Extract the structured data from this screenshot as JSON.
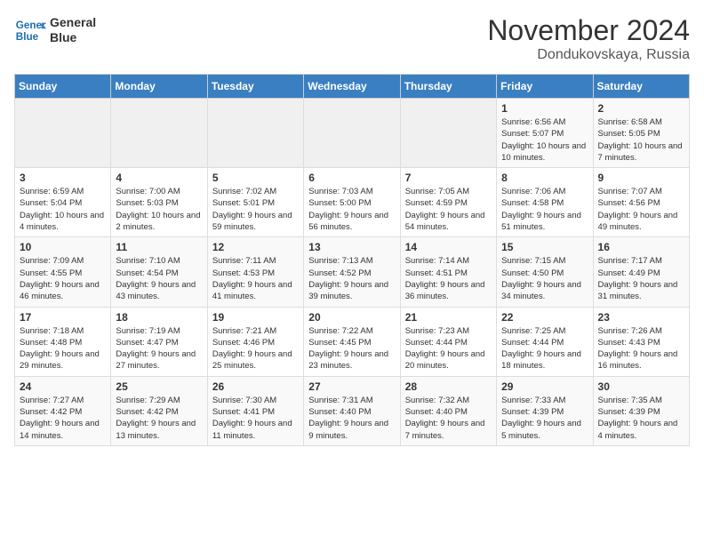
{
  "header": {
    "logo_line1": "General",
    "logo_line2": "Blue",
    "month": "November 2024",
    "location": "Dondukovskaya, Russia"
  },
  "days_of_week": [
    "Sunday",
    "Monday",
    "Tuesday",
    "Wednesday",
    "Thursday",
    "Friday",
    "Saturday"
  ],
  "weeks": [
    [
      {
        "day": "",
        "info": ""
      },
      {
        "day": "",
        "info": ""
      },
      {
        "day": "",
        "info": ""
      },
      {
        "day": "",
        "info": ""
      },
      {
        "day": "",
        "info": ""
      },
      {
        "day": "1",
        "info": "Sunrise: 6:56 AM\nSunset: 5:07 PM\nDaylight: 10 hours and 10 minutes."
      },
      {
        "day": "2",
        "info": "Sunrise: 6:58 AM\nSunset: 5:05 PM\nDaylight: 10 hours and 7 minutes."
      }
    ],
    [
      {
        "day": "3",
        "info": "Sunrise: 6:59 AM\nSunset: 5:04 PM\nDaylight: 10 hours and 4 minutes."
      },
      {
        "day": "4",
        "info": "Sunrise: 7:00 AM\nSunset: 5:03 PM\nDaylight: 10 hours and 2 minutes."
      },
      {
        "day": "5",
        "info": "Sunrise: 7:02 AM\nSunset: 5:01 PM\nDaylight: 9 hours and 59 minutes."
      },
      {
        "day": "6",
        "info": "Sunrise: 7:03 AM\nSunset: 5:00 PM\nDaylight: 9 hours and 56 minutes."
      },
      {
        "day": "7",
        "info": "Sunrise: 7:05 AM\nSunset: 4:59 PM\nDaylight: 9 hours and 54 minutes."
      },
      {
        "day": "8",
        "info": "Sunrise: 7:06 AM\nSunset: 4:58 PM\nDaylight: 9 hours and 51 minutes."
      },
      {
        "day": "9",
        "info": "Sunrise: 7:07 AM\nSunset: 4:56 PM\nDaylight: 9 hours and 49 minutes."
      }
    ],
    [
      {
        "day": "10",
        "info": "Sunrise: 7:09 AM\nSunset: 4:55 PM\nDaylight: 9 hours and 46 minutes."
      },
      {
        "day": "11",
        "info": "Sunrise: 7:10 AM\nSunset: 4:54 PM\nDaylight: 9 hours and 43 minutes."
      },
      {
        "day": "12",
        "info": "Sunrise: 7:11 AM\nSunset: 4:53 PM\nDaylight: 9 hours and 41 minutes."
      },
      {
        "day": "13",
        "info": "Sunrise: 7:13 AM\nSunset: 4:52 PM\nDaylight: 9 hours and 39 minutes."
      },
      {
        "day": "14",
        "info": "Sunrise: 7:14 AM\nSunset: 4:51 PM\nDaylight: 9 hours and 36 minutes."
      },
      {
        "day": "15",
        "info": "Sunrise: 7:15 AM\nSunset: 4:50 PM\nDaylight: 9 hours and 34 minutes."
      },
      {
        "day": "16",
        "info": "Sunrise: 7:17 AM\nSunset: 4:49 PM\nDaylight: 9 hours and 31 minutes."
      }
    ],
    [
      {
        "day": "17",
        "info": "Sunrise: 7:18 AM\nSunset: 4:48 PM\nDaylight: 9 hours and 29 minutes."
      },
      {
        "day": "18",
        "info": "Sunrise: 7:19 AM\nSunset: 4:47 PM\nDaylight: 9 hours and 27 minutes."
      },
      {
        "day": "19",
        "info": "Sunrise: 7:21 AM\nSunset: 4:46 PM\nDaylight: 9 hours and 25 minutes."
      },
      {
        "day": "20",
        "info": "Sunrise: 7:22 AM\nSunset: 4:45 PM\nDaylight: 9 hours and 23 minutes."
      },
      {
        "day": "21",
        "info": "Sunrise: 7:23 AM\nSunset: 4:44 PM\nDaylight: 9 hours and 20 minutes."
      },
      {
        "day": "22",
        "info": "Sunrise: 7:25 AM\nSunset: 4:44 PM\nDaylight: 9 hours and 18 minutes."
      },
      {
        "day": "23",
        "info": "Sunrise: 7:26 AM\nSunset: 4:43 PM\nDaylight: 9 hours and 16 minutes."
      }
    ],
    [
      {
        "day": "24",
        "info": "Sunrise: 7:27 AM\nSunset: 4:42 PM\nDaylight: 9 hours and 14 minutes."
      },
      {
        "day": "25",
        "info": "Sunrise: 7:29 AM\nSunset: 4:42 PM\nDaylight: 9 hours and 13 minutes."
      },
      {
        "day": "26",
        "info": "Sunrise: 7:30 AM\nSunset: 4:41 PM\nDaylight: 9 hours and 11 minutes."
      },
      {
        "day": "27",
        "info": "Sunrise: 7:31 AM\nSunset: 4:40 PM\nDaylight: 9 hours and 9 minutes."
      },
      {
        "day": "28",
        "info": "Sunrise: 7:32 AM\nSunset: 4:40 PM\nDaylight: 9 hours and 7 minutes."
      },
      {
        "day": "29",
        "info": "Sunrise: 7:33 AM\nSunset: 4:39 PM\nDaylight: 9 hours and 5 minutes."
      },
      {
        "day": "30",
        "info": "Sunrise: 7:35 AM\nSunset: 4:39 PM\nDaylight: 9 hours and 4 minutes."
      }
    ]
  ]
}
